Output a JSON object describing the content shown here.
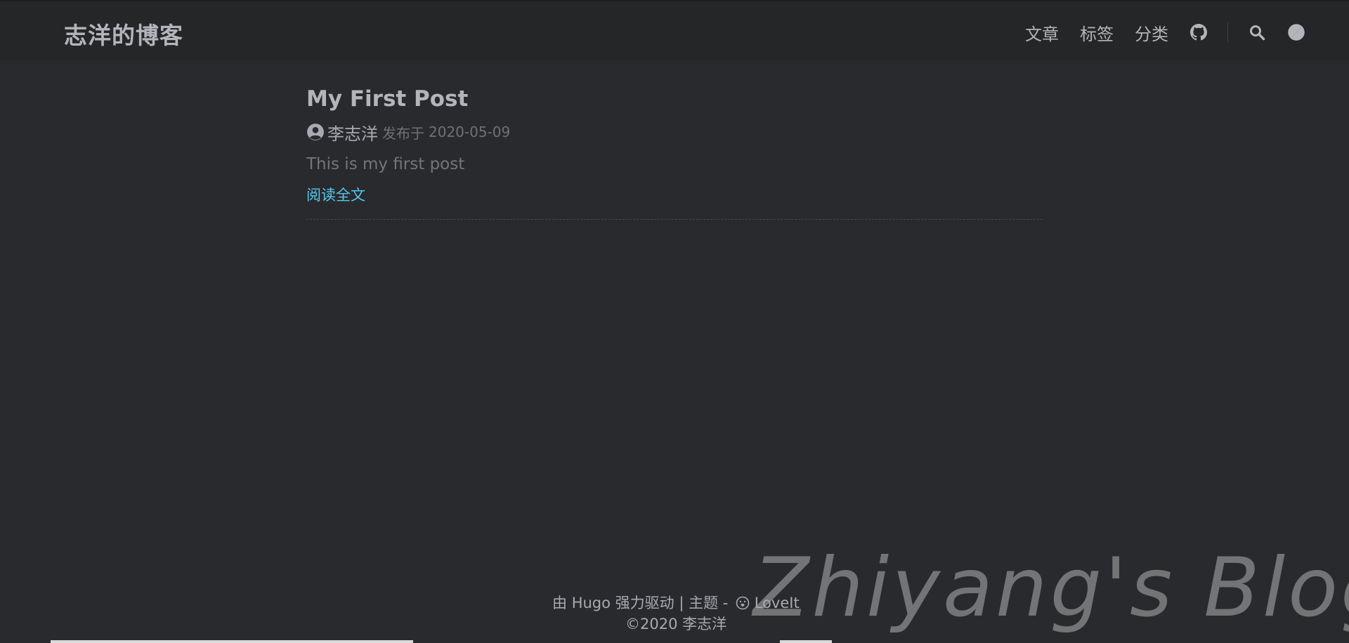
{
  "header": {
    "site_title": "志洋的博客",
    "nav": {
      "posts": "文章",
      "tags": "标签",
      "categories": "分类"
    },
    "icons": {
      "github": "github-icon",
      "search": "search-icon",
      "theme": "theme-toggle-icon"
    }
  },
  "post": {
    "title": "My First Post",
    "author": "李志洋",
    "published_label": "发布于",
    "date": "2020-05-09",
    "summary": "This is my first post",
    "read_more": "阅读全文"
  },
  "footer": {
    "powered_prefix": "由",
    "hugo": "Hugo",
    "powered_suffix": "强力驱动 | 主题 -",
    "theme_name": "LoveIt",
    "copyright": "©2020 李志洋"
  },
  "watermark": "Zhiyang's Blog",
  "colors": {
    "background": "#292a2d",
    "header": "#252627",
    "link": "#56c7f0",
    "text": "#a9a9b3"
  }
}
